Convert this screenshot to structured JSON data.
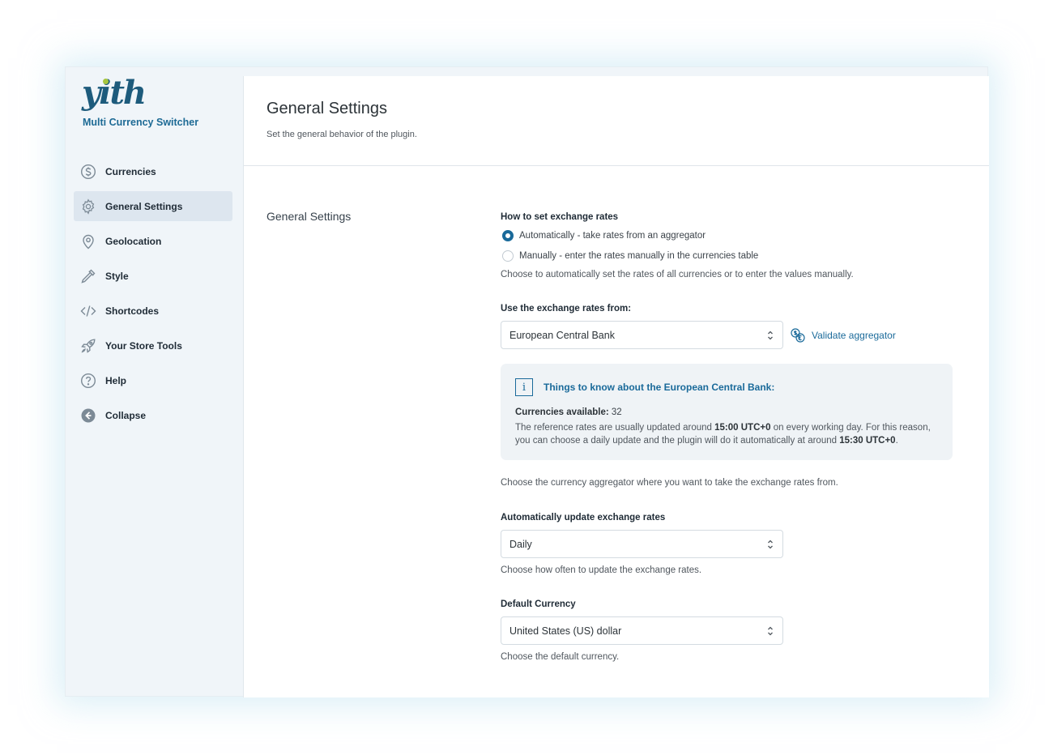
{
  "sidebar": {
    "logo_text": "yith",
    "plugin_name": "Multi Currency Switcher",
    "items": [
      {
        "label": "Currencies",
        "icon": "dollar-circle-icon"
      },
      {
        "label": "General Settings",
        "icon": "gear-icon",
        "active": true
      },
      {
        "label": "Geolocation",
        "icon": "map-pin-icon"
      },
      {
        "label": "Style",
        "icon": "eyedropper-icon"
      },
      {
        "label": "Shortcodes",
        "icon": "code-icon"
      },
      {
        "label": "Your Store Tools",
        "icon": "rocket-icon"
      },
      {
        "label": "Help",
        "icon": "question-circle-icon"
      },
      {
        "label": "Collapse",
        "icon": "collapse-arrow-icon"
      }
    ]
  },
  "header": {
    "title": "General Settings",
    "description": "Set the general behavior of the plugin."
  },
  "section": {
    "title": "General Settings"
  },
  "exchange_rates": {
    "label": "How to set exchange rates",
    "options": [
      {
        "label": "Automatically - take rates from an aggregator",
        "selected": true
      },
      {
        "label": "Manually - enter the rates manually in the currencies table",
        "selected": false
      }
    ],
    "help": "Choose to automatically set the rates of all currencies or to enter the values manually."
  },
  "aggregator": {
    "label": "Use the exchange rates from:",
    "value": "European Central Bank",
    "validate_label": "Validate aggregator",
    "help": "Choose the currency aggregator where you want to take the exchange rates from."
  },
  "infobox": {
    "title": "Things to know about the European Central Bank:",
    "currencies_label": "Currencies available:",
    "currencies_value": "32",
    "text_1": "The reference rates are usually updated around ",
    "time_1": "15:00 UTC+0",
    "text_2": " on every working day. For this reason, you can choose a daily update and the plugin will do it automatically at around ",
    "time_2": "15:30 UTC+0",
    "text_3": "."
  },
  "auto_update": {
    "label": "Automatically update exchange rates",
    "value": "Daily",
    "help": "Choose how often to update the exchange rates."
  },
  "default_currency": {
    "label": "Default Currency",
    "value": "United States (US) dollar",
    "help": "Choose the default currency."
  },
  "colors": {
    "accent": "#1a6a9a",
    "logo_leaf": "#a6c63f",
    "sidebar_bg": "#f0f5f9",
    "active_item_bg": "#dde6ef"
  }
}
